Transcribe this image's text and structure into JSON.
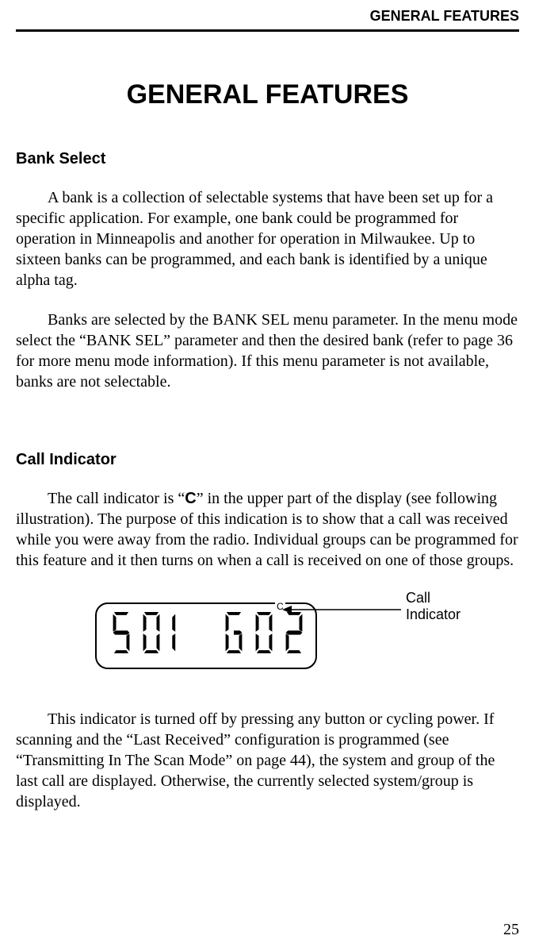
{
  "header": {
    "running": "GENERAL FEATURES"
  },
  "chapter": {
    "title": "GENERAL FEATURES"
  },
  "sections": {
    "bankSelect": {
      "heading": "Bank Select",
      "p1": "A bank is a collection of selectable systems that have been set up for a specific application. For example, one bank could be programmed for operation in Minneapolis and another for operation in Milwaukee. Up to sixteen banks can be programmed, and each bank is identified by a unique alpha tag.",
      "p2": "Banks are selected by the BANK SEL menu parameter. In the menu mode select the “BANK SEL” parameter and then the desired bank (refer to page 36 for more menu mode information). If this menu parameter is not available, banks are not selectable."
    },
    "callIndicator": {
      "heading": "Call Indicator",
      "p1_pre": "The call indicator is “",
      "p1_bold": "C",
      "p1_post": "” in the upper part of the display (see following illustration). The purpose of this indication is to show that a call was received while you were away from the radio. Individual groups can be programmed for this feature and it then turns on when a call is received on one of those groups.",
      "p2": "This indicator is turned off by pressing any button or cycling power. If scanning and the “Last Received” configuration is programmed (see “Transmitting In The Scan Mode” on page 44), the system and group of the last call are displayed. Otherwise, the currently selected system/group is displayed."
    }
  },
  "figure": {
    "cMark": "C",
    "label_line1": "Call",
    "label_line2": "Indicator",
    "display": "S01 G02"
  },
  "page": {
    "number": "25"
  }
}
